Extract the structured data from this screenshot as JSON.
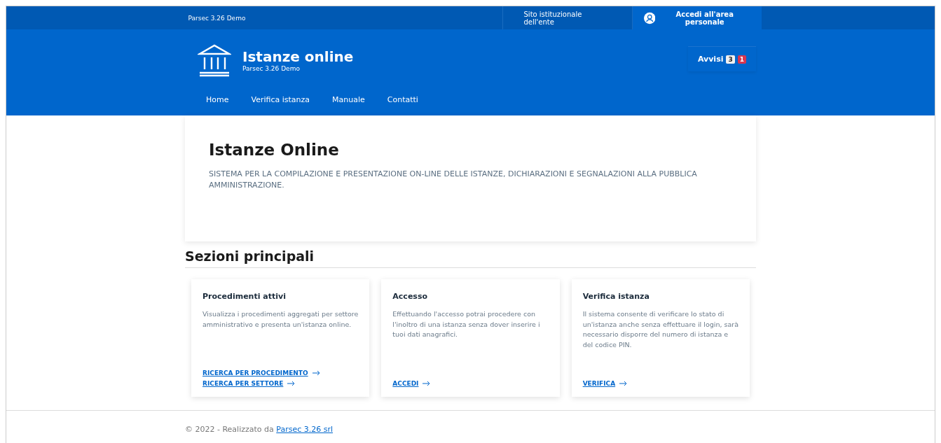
{
  "top_bar": {
    "brand": "Parsec 3.26 Demo",
    "links": [
      {
        "label": "Sito istituzionale dell'ente"
      }
    ],
    "login": "Accedi all'area personale"
  },
  "header": {
    "title": "Istanze online",
    "subtitle": "Parsec 3.26 Demo",
    "notices": {
      "label": "Avvisi",
      "badges": [
        {
          "text": "3",
          "kind": "neutral"
        },
        {
          "text": "1",
          "kind": "alert"
        }
      ]
    }
  },
  "nav": [
    {
      "label": "Home"
    },
    {
      "label": "Verifica istanza"
    },
    {
      "label": "Manuale"
    },
    {
      "label": "Contatti"
    }
  ],
  "hero": {
    "title": "Istanze Online",
    "text": "SISTEMA PER LA COMPILAZIONE E PRESENTAZIONE ON-LINE DELLE ISTANZE, DICHIARAZIONI E SEGNALAZIONI ALLA PUBBLICA AMMINISTRAZIONE."
  },
  "sections": {
    "title": "Sezioni principali",
    "cards": [
      {
        "title": "Procedimenti attivi",
        "text": "Visualizza i procedimenti aggregati per settore amministrativo e presenta un'istanza online.",
        "links": [
          "RICERCA PER PROCEDIMENTO",
          "RICERCA PER SETTORE"
        ]
      },
      {
        "title": "Accesso",
        "text": "Effettuando l'accesso potrai procedere con l'inoltro di una istanza senza dover inserire i tuoi dati anagrafici.",
        "links": [
          "ACCEDI"
        ]
      },
      {
        "title": "Verifica istanza",
        "text": "Il sistema consente di verificare lo stato di un'istanza anche senza effettuare il login, sarà necessario disporre del numero di istanza e del codice PIN.",
        "links": [
          "VERIFICA"
        ]
      }
    ]
  },
  "footer": {
    "text": "© 2022 - Realizzato da",
    "link": "Parsec 3.26 srl"
  }
}
